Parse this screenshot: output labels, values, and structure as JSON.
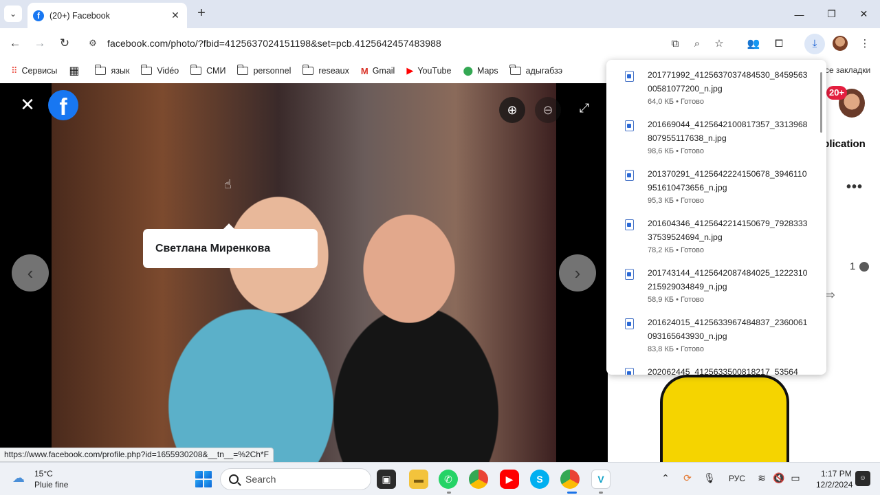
{
  "browser": {
    "tab_title": "(20+) Facebook",
    "url": "facebook.com/photo/?fbid=4125637024151198&set=pcb.4125642457483988",
    "bookmarks": [
      {
        "label": "Сервисы",
        "type": "apps"
      },
      {
        "label": "",
        "type": "grid"
      },
      {
        "label": "язык",
        "type": "folder"
      },
      {
        "label": "Vidéo",
        "type": "folder"
      },
      {
        "label": "СМИ",
        "type": "folder"
      },
      {
        "label": "personnel",
        "type": "folder"
      },
      {
        "label": "reseaux",
        "type": "folder"
      },
      {
        "label": "Gmail",
        "type": "gmail"
      },
      {
        "label": "YouTube",
        "type": "youtube"
      },
      {
        "label": "Maps",
        "type": "maps"
      },
      {
        "label": "адыгабзэ",
        "type": "folder"
      }
    ],
    "bookmarks_more": "се закладки",
    "status_url": "https://www.facebook.com/profile.php?id=1655930208&__tn__=%2Ch*F"
  },
  "viewer": {
    "tag_name": "Светлана Миренкова"
  },
  "fb_side": {
    "notif_count": "20+",
    "publication_label": "ublication",
    "comment_count": "1"
  },
  "downloads": {
    "items": [
      {
        "name": "201771992_4125637037484530_845956300581077200_n.jpg",
        "meta": "64,0 КБ • Готово"
      },
      {
        "name": "201669044_4125642100817357_3313968807955117638_n.jpg",
        "meta": "98,6 КБ • Готово"
      },
      {
        "name": "201370291_4125642224150678_3946110951610473656_n.jpg",
        "meta": "95,3 КБ • Готово"
      },
      {
        "name": "201604346_4125642214150679_792833337539524694_n.jpg",
        "meta": "78,2 КБ • Готово"
      },
      {
        "name": "201743144_4125642087484025_1222310215929034849_n.jpg",
        "meta": "58,9 КБ • Готово"
      },
      {
        "name": "201624015_4125633967484837_2360061093165643930_n.jpg",
        "meta": "83,8 КБ • Готово"
      },
      {
        "name": "202062445_4125633500818217_53564",
        "meta": ""
      }
    ]
  },
  "taskbar": {
    "weather_temp": "15°C",
    "weather_desc": "Pluie fine",
    "search_placeholder": "Search",
    "language": "РУС",
    "time": "1:17 PM",
    "date": "12/2/2024"
  },
  "colors": {
    "facebook_blue": "#1877f2",
    "tabstrip_bg": "#dfe5f1",
    "download_accent": "#0b57d0"
  }
}
